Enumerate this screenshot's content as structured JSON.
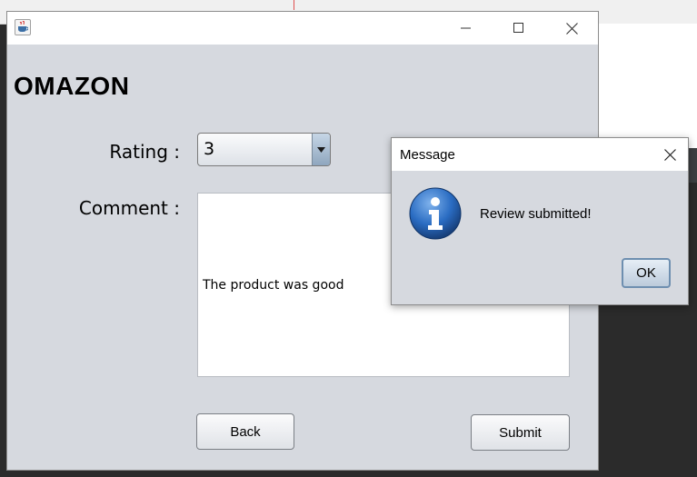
{
  "main_window": {
    "app_title": "OMAZON",
    "rating_label": "Rating  :",
    "rating_value": "3",
    "comment_label": "Comment :",
    "comment_text": "The product was good",
    "back_label": "Back",
    "submit_label": "Submit"
  },
  "dialog": {
    "title": "Message",
    "message": "Review submitted!",
    "ok_label": "OK"
  },
  "icons": {
    "app": "java-cup-icon",
    "info": "information-icon",
    "dropdown": "triangle-down-icon"
  },
  "colors": {
    "window_bg": "#d6d9df",
    "info_icon_blue": "#1f5fb4",
    "ok_border": "#6e8fb0"
  }
}
